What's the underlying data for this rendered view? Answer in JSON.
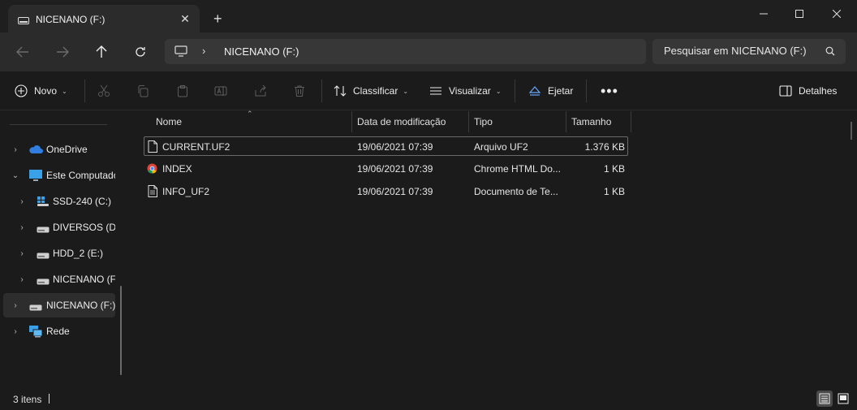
{
  "tab": {
    "title": "NICENANO (F:)"
  },
  "address": {
    "path": "NICENANO (F:)"
  },
  "search": {
    "placeholder": "Pesquisar em NICENANO (F:)"
  },
  "commands": {
    "novo": "Novo",
    "classificar": "Classificar",
    "visualizar": "Visualizar",
    "ejetar": "Ejetar",
    "detalhes": "Detalhes"
  },
  "sidebar": {
    "items": [
      {
        "label": "OneDrive",
        "icon": "onedrive-icon",
        "expanded": false
      },
      {
        "label": "Este Computador",
        "icon": "computer-icon",
        "expanded": true
      },
      {
        "label": "SSD-240 (C:)",
        "icon": "windows-drive-icon"
      },
      {
        "label": "DIVERSOS (D:)",
        "icon": "drive-icon"
      },
      {
        "label": "HDD_2 (E:)",
        "icon": "drive-icon"
      },
      {
        "label": "NICENANO (F:)",
        "icon": "drive-icon"
      },
      {
        "label": "NICENANO (F:)",
        "icon": "drive-icon",
        "selected": true
      },
      {
        "label": "Rede",
        "icon": "network-icon"
      }
    ]
  },
  "columns": {
    "name": "Nome",
    "modified": "Data de modificação",
    "type": "Tipo",
    "size": "Tamanho"
  },
  "files": [
    {
      "name": "CURRENT.UF2",
      "modified": "19/06/2021 07:39",
      "type": "Arquivo UF2",
      "size": "1.376 KB",
      "icon": "file-icon"
    },
    {
      "name": "INDEX",
      "modified": "19/06/2021 07:39",
      "type": "Chrome HTML Do...",
      "size": "1 KB",
      "icon": "chrome-icon"
    },
    {
      "name": "INFO_UF2",
      "modified": "19/06/2021 07:39",
      "type": "Documento de Te...",
      "size": "1 KB",
      "icon": "text-file-icon"
    }
  ],
  "status": {
    "count": "3 itens"
  }
}
